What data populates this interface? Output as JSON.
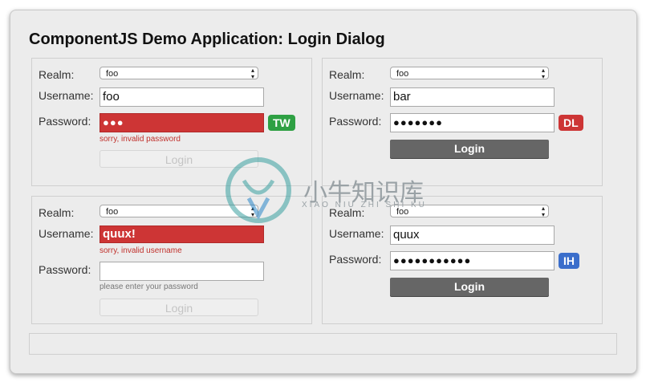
{
  "app": {
    "title": "ComponentJS Demo Application: Login Dialog"
  },
  "labels": {
    "realm": "Realm:",
    "username": "Username:",
    "password": "Password:"
  },
  "dialogs": [
    {
      "realm": "foo",
      "username": "foo",
      "password": "●●●",
      "password_error": "sorry, invalid password",
      "badge": "TW",
      "badge_color": "#2ea043",
      "login_label": "Login",
      "login_enabled": false
    },
    {
      "realm": "foo",
      "username": "bar",
      "password": "●●●●●●●",
      "badge": "DL",
      "badge_color": "#cd3535",
      "login_label": "Login",
      "login_enabled": true
    },
    {
      "realm": "foo",
      "username": "quux!",
      "username_error": "sorry, invalid username",
      "password": "",
      "password_hint": "please enter your password",
      "login_label": "Login",
      "login_enabled": false
    },
    {
      "realm": "foo",
      "username": "quux",
      "password": "●●●●●●●●●●●",
      "badge": "IH",
      "badge_color": "#3b6ecb",
      "login_label": "Login",
      "login_enabled": true
    }
  ],
  "watermark": {
    "text": "小牛知识库",
    "subtext": "XIAO NIU ZHI SHI KU"
  },
  "colors": {
    "error": "#cd3535",
    "button_active": "#666666"
  }
}
